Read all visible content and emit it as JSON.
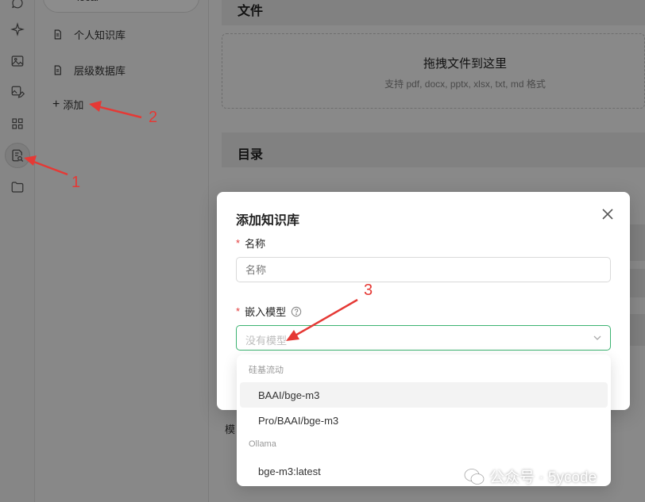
{
  "kb_list": {
    "top_partial": "local",
    "items": [
      {
        "label": "个人知识库"
      },
      {
        "label": "层级数据库"
      }
    ],
    "add_label": "添加"
  },
  "main": {
    "files_header": "文件",
    "drop_title": "拖拽文件到这里",
    "drop_sub": "支持 pdf, docx, pptx, xlsx, txt, md 格式",
    "dir_header": "目录",
    "model_label_partial": "模"
  },
  "modal": {
    "title": "添加知识库",
    "name_label": "名称",
    "name_placeholder": "名称",
    "embed_label": "嵌入模型",
    "embed_placeholder": "没有模型"
  },
  "dropdown": {
    "groups": [
      {
        "label": "硅基流动",
        "options": [
          "BAAI/bge-m3",
          "Pro/BAAI/bge-m3"
        ]
      },
      {
        "label": "Ollama",
        "options": [
          "bge-m3:latest"
        ]
      }
    ],
    "hovered_option": "BAAI/bge-m3"
  },
  "annotations": {
    "n1": "1",
    "n2": "2",
    "n3": "3",
    "color": "#e53935"
  },
  "watermark": {
    "text": "公众号 · 5ycode"
  }
}
